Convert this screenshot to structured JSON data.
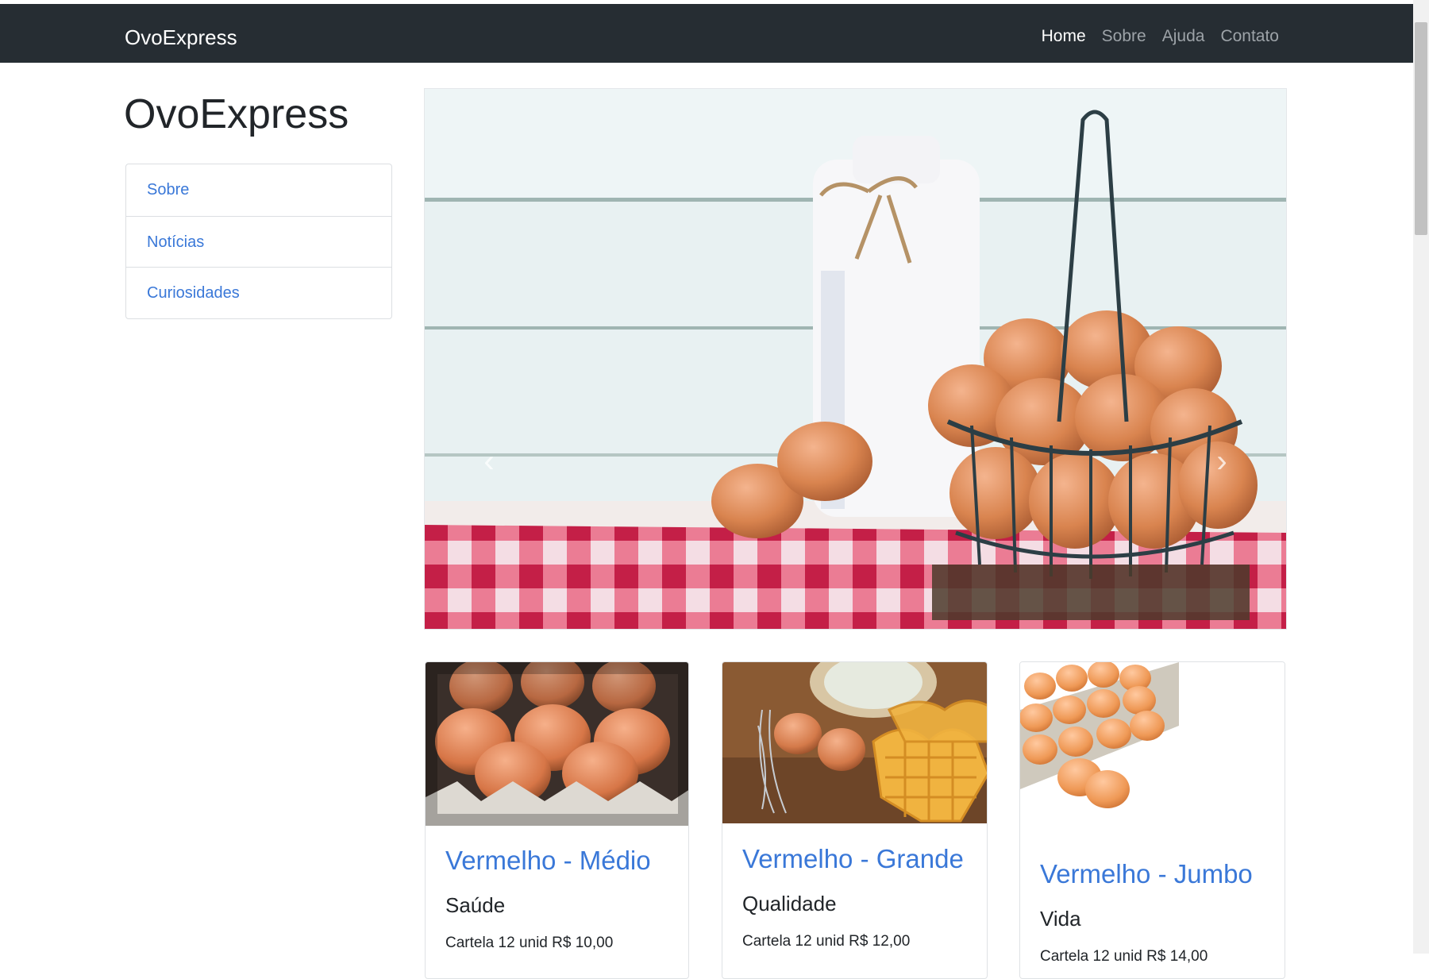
{
  "navbar": {
    "brand": "OvoExpress",
    "links": [
      {
        "label": "Home",
        "active": true
      },
      {
        "label": "Sobre",
        "active": false
      },
      {
        "label": "Ajuda",
        "active": false
      },
      {
        "label": "Contato",
        "active": false
      }
    ]
  },
  "sidebar": {
    "title": "OvoExpress",
    "items": [
      {
        "label": "Sobre"
      },
      {
        "label": "Notícias"
      },
      {
        "label": "Curiosidades"
      }
    ]
  },
  "carousel": {
    "prev_icon": "chevron-left-icon",
    "next_icon": "chevron-right-icon",
    "prev_glyph": "‹",
    "next_glyph": "›"
  },
  "cards": [
    {
      "title": "Vermelho - Médio",
      "subtitle": "Saúde",
      "text": "Cartela 12 unid R$ 10,00"
    },
    {
      "title": "Vermelho - Grande",
      "subtitle": "Qualidade",
      "text": "Cartela 12 unid R$ 12,00"
    },
    {
      "title": "Vermelho - Jumbo",
      "subtitle": "Vida",
      "text": "Cartela 12 unid R$ 14,00"
    }
  ],
  "colors": {
    "navbar_bg": "#262d33",
    "link": "#3a78d8",
    "text": "#212529"
  }
}
